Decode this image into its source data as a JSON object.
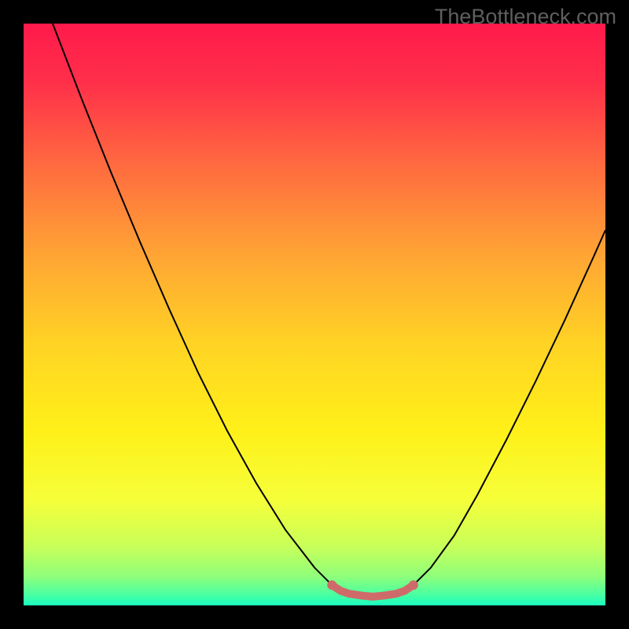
{
  "watermark": "TheBottleneck.com",
  "chart_data": {
    "type": "line",
    "title": "",
    "xlabel": "",
    "ylabel": "",
    "xlim": [
      0,
      1
    ],
    "ylim": [
      0,
      1
    ],
    "gradient_stops": [
      {
        "offset": 0.0,
        "color": "#ff1a4b"
      },
      {
        "offset": 0.1,
        "color": "#ff2f4a"
      },
      {
        "offset": 0.25,
        "color": "#ff6d3f"
      },
      {
        "offset": 0.4,
        "color": "#ffa534"
      },
      {
        "offset": 0.55,
        "color": "#ffd324"
      },
      {
        "offset": 0.7,
        "color": "#fff019"
      },
      {
        "offset": 0.82,
        "color": "#f5ff3a"
      },
      {
        "offset": 0.9,
        "color": "#c7ff5a"
      },
      {
        "offset": 0.95,
        "color": "#8fff7a"
      },
      {
        "offset": 0.98,
        "color": "#4dffa0"
      },
      {
        "offset": 1.0,
        "color": "#1affc0"
      }
    ],
    "series": [
      {
        "name": "bottleneck-curve",
        "color": "#000000",
        "width": 2,
        "points": [
          {
            "x": 0.05,
            "y": 1.0
          },
          {
            "x": 0.1,
            "y": 0.87
          },
          {
            "x": 0.15,
            "y": 0.745
          },
          {
            "x": 0.2,
            "y": 0.625
          },
          {
            "x": 0.25,
            "y": 0.51
          },
          {
            "x": 0.3,
            "y": 0.4
          },
          {
            "x": 0.35,
            "y": 0.3
          },
          {
            "x": 0.4,
            "y": 0.21
          },
          {
            "x": 0.45,
            "y": 0.13
          },
          {
            "x": 0.5,
            "y": 0.065
          },
          {
            "x": 0.53,
            "y": 0.035
          },
          {
            "x": 0.56,
            "y": 0.02
          },
          {
            "x": 0.6,
            "y": 0.015
          },
          {
            "x": 0.64,
            "y": 0.02
          },
          {
            "x": 0.67,
            "y": 0.035
          },
          {
            "x": 0.7,
            "y": 0.065
          },
          {
            "x": 0.74,
            "y": 0.12
          },
          {
            "x": 0.78,
            "y": 0.19
          },
          {
            "x": 0.83,
            "y": 0.285
          },
          {
            "x": 0.88,
            "y": 0.385
          },
          {
            "x": 0.93,
            "y": 0.49
          },
          {
            "x": 0.98,
            "y": 0.6
          },
          {
            "x": 1.0,
            "y": 0.645
          }
        ]
      },
      {
        "name": "bottom-marker",
        "color": "#cf6a6a",
        "width": 10,
        "points": [
          {
            "x": 0.53,
            "y": 0.035
          },
          {
            "x": 0.545,
            "y": 0.025
          },
          {
            "x": 0.56,
            "y": 0.02
          },
          {
            "x": 0.58,
            "y": 0.017
          },
          {
            "x": 0.6,
            "y": 0.015
          },
          {
            "x": 0.62,
            "y": 0.017
          },
          {
            "x": 0.64,
            "y": 0.02
          },
          {
            "x": 0.655,
            "y": 0.025
          },
          {
            "x": 0.67,
            "y": 0.035
          }
        ]
      }
    ]
  }
}
